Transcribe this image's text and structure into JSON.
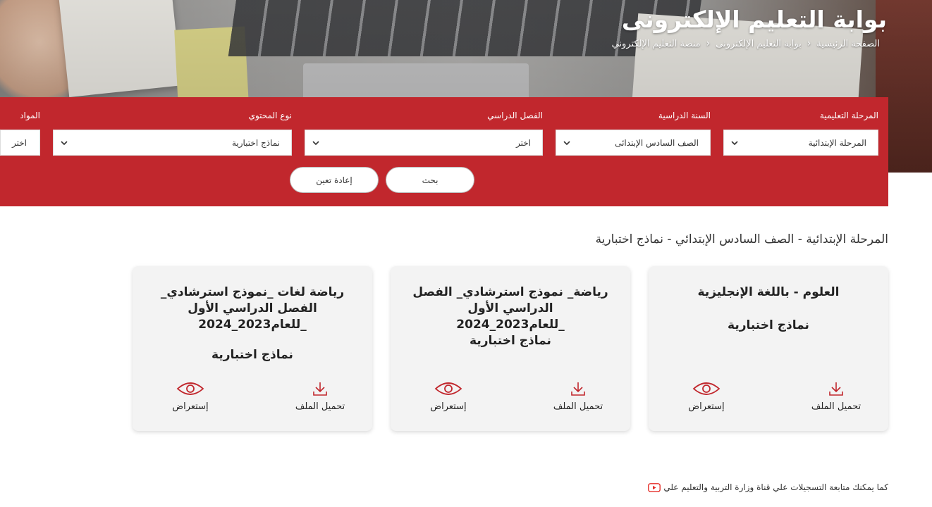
{
  "header": {
    "title": "بوابة التعليم الإلكترونى",
    "breadcrumb": [
      "الصفحة الرئيسية",
      "بوابة التعليم الإلكترونى",
      "منصة التعليم الإلكتروني"
    ]
  },
  "filters": {
    "stage": {
      "label": "المرحلة التعليمية",
      "value": "المرحلة الإبتدائية"
    },
    "year": {
      "label": "السنة الدراسية",
      "value": "الصف السادس الإبتدائى"
    },
    "term": {
      "label": "الفصل الدراسي",
      "value": "اختر"
    },
    "content_type": {
      "label": "نوع المحتوي",
      "value": "نماذج اختبارية"
    },
    "subject": {
      "label": "المواد",
      "value": "اختر"
    },
    "search_label": "بحث",
    "reset_label": "إعادة تعين"
  },
  "results": {
    "heading": "المرحلة الإبتدائية - الصف السادس الإبتدائي - نماذج اختبارية",
    "cards": [
      {
        "title": "العلوم - باللغة الإنجليزية",
        "type": "نماذج اختبارية",
        "download": "تحميل الملف",
        "view": "إستعراض"
      },
      {
        "title": "رياضة_ نموذج استرشادي_ الفصل الدراسي الأول _للعام2023_2024",
        "type": "نماذج اختبارية",
        "download": "تحميل الملف",
        "view": "إستعراض"
      },
      {
        "title": "رياضة لغات _نموذج استرشادي_ الفصل الدراسي الأول _للعام2023_2024",
        "type": "نماذج اختبارية",
        "download": "تحميل الملف",
        "view": "إستعراض"
      }
    ]
  },
  "footer": {
    "note": "كما يمكنك متابعة التسجيلات علي قناة وزارة التربية والتعليم علي"
  },
  "colors": {
    "brand_red": "#c1272d",
    "icon_red": "#c1272d",
    "youtube_red": "#e52d27"
  }
}
